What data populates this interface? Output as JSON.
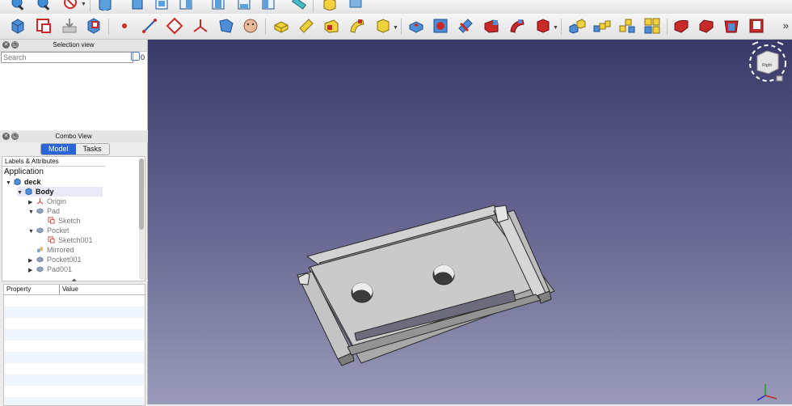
{
  "toolbar_top": {
    "icons": [
      "zoom-fit-icon",
      "zoom-selection-icon",
      "draw-style-icon",
      "isometric-view-icon",
      "front-view-icon",
      "top-view-icon",
      "right-view-icon",
      "rear-view-icon",
      "bottom-view-icon",
      "left-view-icon",
      "measure-icon",
      "part-icon",
      "view-box-icon"
    ]
  },
  "toolbar_main": {
    "icons": [
      "create-body-icon",
      "create-sketch-icon",
      "validate-sketch-icon",
      "map-sketch-icon",
      "datum-point-icon",
      "datum-line-icon",
      "datum-plane-icon",
      "local-coordinate-system-icon",
      "shape-binder-icon",
      "clone-icon",
      "pad-icon",
      "revolution-icon",
      "additive-loft-icon",
      "additive-pipe-icon",
      "additive-primitive-icon",
      "pocket-icon",
      "hole-icon",
      "groove-icon",
      "subtractive-loft-icon",
      "subtractive-pipe-icon",
      "subtractive-primitive-icon",
      "mirrored-icon",
      "linear-pattern-icon",
      "polar-pattern-icon",
      "multi-transform-icon",
      "fillet-icon",
      "chamfer-icon",
      "draft-icon",
      "thickness-icon"
    ],
    "overflow_chevron": "»"
  },
  "selection_view": {
    "title": "Selection view",
    "search_placeholder": "Search",
    "count": "0"
  },
  "combo_view": {
    "title": "Combo View",
    "tabs": [
      {
        "label": "Model",
        "active": true
      },
      {
        "label": "Tasks",
        "active": false
      }
    ],
    "tree_header": "Labels & Attributes",
    "tree": {
      "root": "Application",
      "document": "deck",
      "body": "Body",
      "items": [
        {
          "label": "Origin",
          "arrow": "▶"
        },
        {
          "label": "Pad",
          "arrow": "▼"
        },
        {
          "label": "Sketch",
          "arrow": ""
        },
        {
          "label": "Pocket",
          "arrow": "▼"
        },
        {
          "label": "Sketch001",
          "arrow": ""
        },
        {
          "label": "Mirrored",
          "arrow": ""
        },
        {
          "label": "Pocket001",
          "arrow": "▶"
        },
        {
          "label": "Pad001",
          "arrow": "▶"
        }
      ]
    }
  },
  "property_view": {
    "col_property": "Property",
    "col_value": "Value"
  },
  "viewport": {
    "background_top": "#3a3a6a",
    "background_bottom": "#9a9ab8",
    "nav_cube_face": "Right",
    "model_color": "#c8c8c8"
  }
}
